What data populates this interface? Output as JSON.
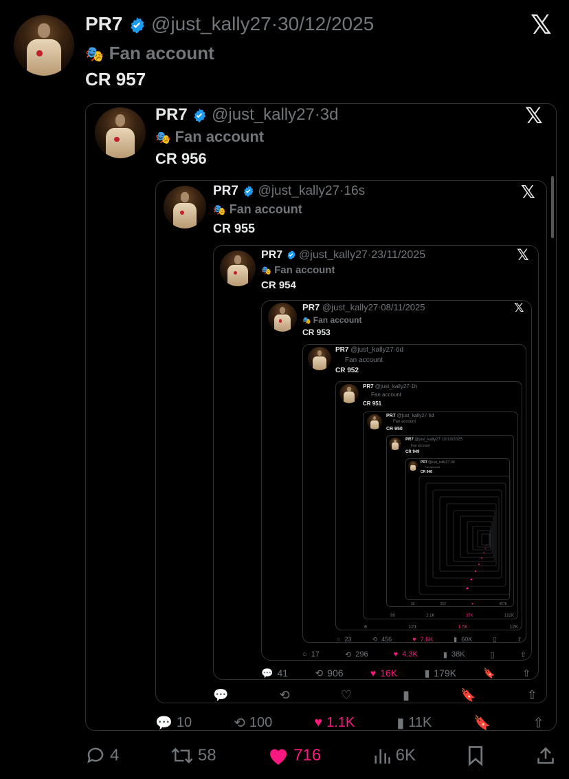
{
  "main": {
    "name": "PR7",
    "handle": "@just_kally27",
    "dot": "·",
    "date": "30/12/2025",
    "label_icon": "theater-mask-icon",
    "label": "Fan account",
    "text": "CR 957",
    "replies": "4",
    "reposts": "58",
    "likes": "716",
    "views": "6K"
  },
  "q1": {
    "name": "PR7",
    "handle": "@just_kally27",
    "dot": "·",
    "date": "3d",
    "label": "Fan account",
    "text": "CR 956",
    "replies": "10",
    "reposts": "100",
    "likes": "1.1K",
    "views": "11K"
  },
  "q2": {
    "name": "PR7",
    "handle": "@just_kally27",
    "dot": "·",
    "date": "16s",
    "label": "Fan account",
    "text": "CR 955",
    "replies": "",
    "reposts": "",
    "likes": "",
    "views": ""
  },
  "q3": {
    "name": "PR7",
    "handle": "@just_kally27",
    "dot": "·",
    "date": "23/11/2025",
    "label": "Fan account",
    "text": "CR 954",
    "replies": "41",
    "reposts": "906",
    "likes": "16K",
    "views": "179K"
  },
  "q4": {
    "name": "PR7",
    "handle": "@just_kally27",
    "dot": "·",
    "date": "08/11/2025",
    "label": "Fan account",
    "text": "CR 953",
    "replies": "17",
    "reposts": "296",
    "likes": "4.3K",
    "views": "38K"
  },
  "q5": {
    "name": "PR7",
    "handle": "@just_kally27",
    "dot": "·",
    "date": "6d",
    "label": "Fan account",
    "text": "CR 952",
    "replies": "23",
    "reposts": "456",
    "likes": "7.6K",
    "views": "60K"
  },
  "q6": {
    "name": "PR7",
    "handle": "@just_kally27",
    "dot": "·",
    "date": "1h",
    "label": "Fan account",
    "text": "CR 951",
    "replies": "8",
    "reposts": "121",
    "likes": "1.5K",
    "views": "12K"
  },
  "q7": {
    "name": "PR7",
    "handle": "@just_kally27",
    "dot": "·",
    "date": "6d",
    "label": "Fan account",
    "text": "CR 950",
    "replies": "99",
    "reposts": "2.1K",
    "likes": "35K",
    "views": "122K"
  },
  "q8": {
    "name": "PR7",
    "handle": "@just_kally27",
    "dot": "·",
    "date": "10/10/2025",
    "label": "Fan account",
    "text": "CR 949",
    "replies": "32",
    "reposts": "912",
    "likes": "",
    "views": "457K"
  },
  "q9": {
    "name": "PR7",
    "handle": "@just_kally27",
    "dot": "·",
    "date": "3d",
    "label": "Fan account",
    "text": "CR 948"
  },
  "colors": {
    "background": "#000000",
    "text": "#e7e9ea",
    "muted": "#71767b",
    "verified": "#1d9bf0",
    "like": "#f91880",
    "border": "#2f3336"
  },
  "icons": {
    "x_logo": "x-logo-icon",
    "verified": "verified-badge-icon",
    "reply": "reply-icon",
    "repost": "repost-icon",
    "like": "heart-icon",
    "views": "views-icon",
    "bookmark": "bookmark-icon",
    "share": "share-icon"
  }
}
